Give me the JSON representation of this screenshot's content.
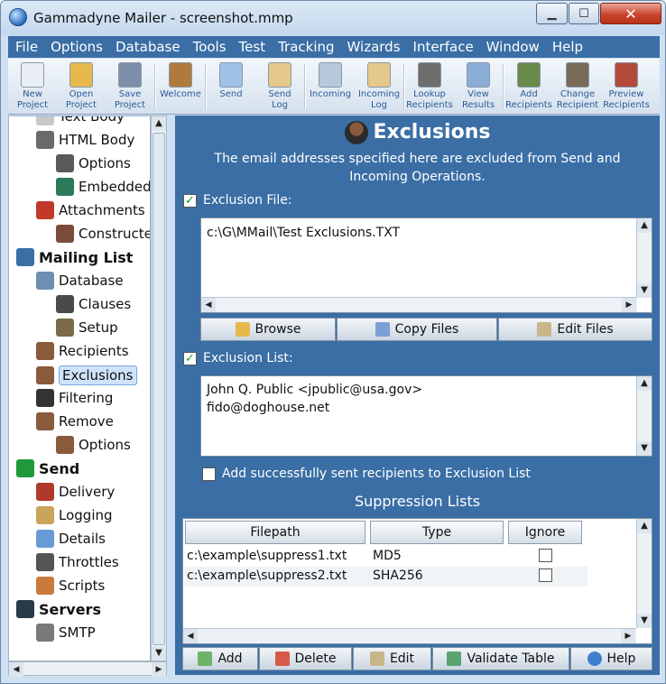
{
  "window": {
    "title": "Gammadyne Mailer - screenshot.mmp"
  },
  "menu": [
    "File",
    "Options",
    "Database",
    "Tools",
    "Test",
    "Tracking",
    "Wizards",
    "Interface",
    "Window",
    "Help"
  ],
  "toolbar": [
    {
      "label": "New\nProject",
      "icon": "new-project-icon"
    },
    {
      "label": "Open\nProject",
      "icon": "open-project-icon"
    },
    {
      "label": "Save\nProject",
      "icon": "save-project-icon"
    },
    {
      "label": "Welcome",
      "icon": "welcome-icon"
    },
    {
      "label": "Send",
      "icon": "send-icon"
    },
    {
      "label": "Send\nLog",
      "icon": "send-log-icon"
    },
    {
      "label": "Incoming",
      "icon": "incoming-icon"
    },
    {
      "label": "Incoming\nLog",
      "icon": "incoming-log-icon"
    },
    {
      "label": "Lookup\nRecipients",
      "icon": "lookup-recipients-icon"
    },
    {
      "label": "View\nResults",
      "icon": "view-results-icon"
    },
    {
      "label": "Add\nRecipients",
      "icon": "add-recipients-icon"
    },
    {
      "label": "Change\nRecipient",
      "icon": "change-recipient-icon"
    },
    {
      "label": "Preview\nRecipients",
      "icon": "preview-recipients-icon"
    }
  ],
  "tree": [
    {
      "label": "Text Body",
      "level": 2,
      "icon": "text-body-icon"
    },
    {
      "label": "HTML Body",
      "level": 2,
      "icon": "html-body-icon"
    },
    {
      "label": "Options",
      "level": 3,
      "icon": "options-icon"
    },
    {
      "label": "Embedded",
      "level": 3,
      "icon": "embedded-icon"
    },
    {
      "label": "Attachments",
      "level": 2,
      "icon": "attachments-icon"
    },
    {
      "label": "Constructed",
      "level": 3,
      "icon": "constructed-icon"
    },
    {
      "label": "Mailing List",
      "level": 1,
      "icon": "mailing-list-icon"
    },
    {
      "label": "Database",
      "level": 2,
      "icon": "database-icon"
    },
    {
      "label": "Clauses",
      "level": 3,
      "icon": "clauses-icon"
    },
    {
      "label": "Setup",
      "level": 3,
      "icon": "setup-icon"
    },
    {
      "label": "Recipients",
      "level": 2,
      "icon": "recipients-icon"
    },
    {
      "label": "Exclusions",
      "level": 2,
      "icon": "exclusions-icon",
      "selected": true
    },
    {
      "label": "Filtering",
      "level": 2,
      "icon": "filtering-icon"
    },
    {
      "label": "Remove",
      "level": 2,
      "icon": "remove-icon"
    },
    {
      "label": "Options",
      "level": 3,
      "icon": "remove-options-icon"
    },
    {
      "label": "Send",
      "level": 1,
      "icon": "send-section-icon"
    },
    {
      "label": "Delivery",
      "level": 2,
      "icon": "delivery-icon"
    },
    {
      "label": "Logging",
      "level": 2,
      "icon": "logging-icon"
    },
    {
      "label": "Details",
      "level": 2,
      "icon": "details-icon"
    },
    {
      "label": "Throttles",
      "level": 2,
      "icon": "throttles-icon"
    },
    {
      "label": "Scripts",
      "level": 2,
      "icon": "scripts-icon"
    },
    {
      "label": "Servers",
      "level": 1,
      "icon": "servers-icon"
    },
    {
      "label": "SMTP",
      "level": 2,
      "icon": "smtp-icon"
    }
  ],
  "panel": {
    "title": "Exclusions",
    "description": "The email addresses specified here are excluded from Send and Incoming Operations.",
    "exclusion_file_label": "Exclusion File:",
    "exclusion_file_checked": true,
    "exclusion_file_path": "c:\\G\\MMail\\Test Exclusions.TXT",
    "file_buttons": [
      "Browse",
      "Copy Files",
      "Edit Files"
    ],
    "exclusion_list_label": "Exclusion List:",
    "exclusion_list_checked": true,
    "exclusion_list": [
      "John Q. Public <jpublic@usa.gov>",
      "fido@doghouse.net"
    ],
    "add_sent_label": "Add successfully sent recipients to Exclusion List",
    "add_sent_checked": false,
    "suppression_title": "Suppression Lists",
    "columns": [
      "Filepath",
      "Type",
      "Ignore"
    ],
    "rows": [
      {
        "filepath": "c:\\example\\suppress1.txt",
        "type": "MD5",
        "ignore": false
      },
      {
        "filepath": "c:\\example\\suppress2.txt",
        "type": "SHA256",
        "ignore": false
      }
    ],
    "table_buttons": [
      "Add",
      "Delete",
      "Edit",
      "Validate Table",
      "Help"
    ]
  }
}
